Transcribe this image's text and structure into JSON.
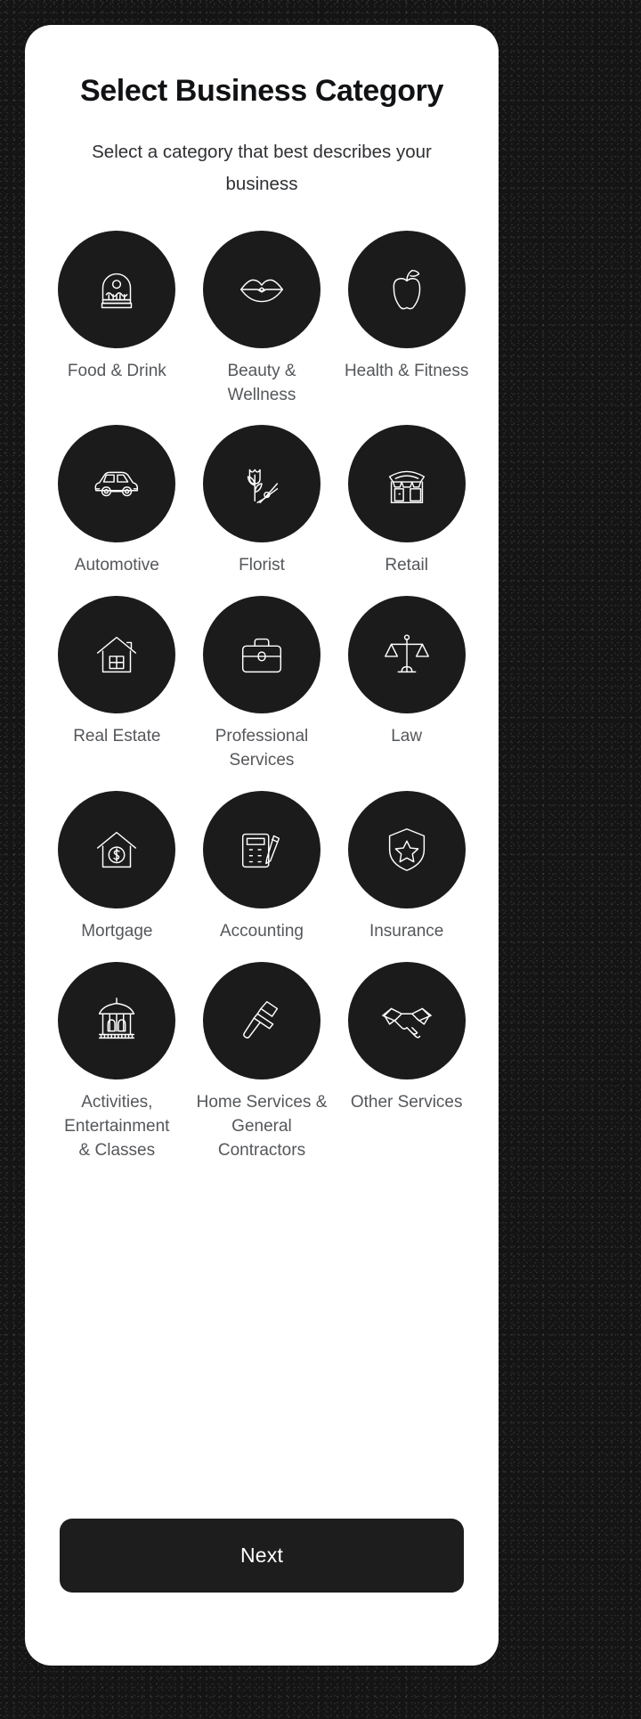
{
  "screen": {
    "title": "Select Business Category",
    "subtitle": "Select a category that best describes your business"
  },
  "colors": {
    "circle_background": "#1b1b1b",
    "icon_stroke": "#ffffff",
    "label_text": "#55575a",
    "title_text": "#111214",
    "card_background": "#ffffff",
    "page_background": "#121212",
    "button_background": "#1d1d1d",
    "button_text": "#ffffff"
  },
  "categories": [
    {
      "label": "Food & Drink",
      "icon": "cupcake-icon"
    },
    {
      "label": "Beauty &\nWellness",
      "icon": "lips-icon"
    },
    {
      "label": "Health & Fitness",
      "icon": "apple-icon"
    },
    {
      "label": "Automotive",
      "icon": "car-icon"
    },
    {
      "label": "Florist",
      "icon": "tulip-shears-icon"
    },
    {
      "label": "Retail",
      "icon": "storefront-icon"
    },
    {
      "label": "Real Estate",
      "icon": "house-icon"
    },
    {
      "label": "Professional\nServices",
      "icon": "briefcase-icon"
    },
    {
      "label": "Law",
      "icon": "scales-icon"
    },
    {
      "label": "Mortgage",
      "icon": "house-dollar-icon"
    },
    {
      "label": "Accounting",
      "icon": "calculator-pen-icon"
    },
    {
      "label": "Insurance",
      "icon": "shield-star-icon"
    },
    {
      "label": "Activities,\nEntertainment\n& Classes",
      "icon": "carousel-icon"
    },
    {
      "label": "Home Services &\nGeneral\nContractors",
      "icon": "hammer-icon"
    },
    {
      "label": "Other Services",
      "icon": "handshake-icon"
    }
  ],
  "footer": {
    "next_label": "Next"
  }
}
